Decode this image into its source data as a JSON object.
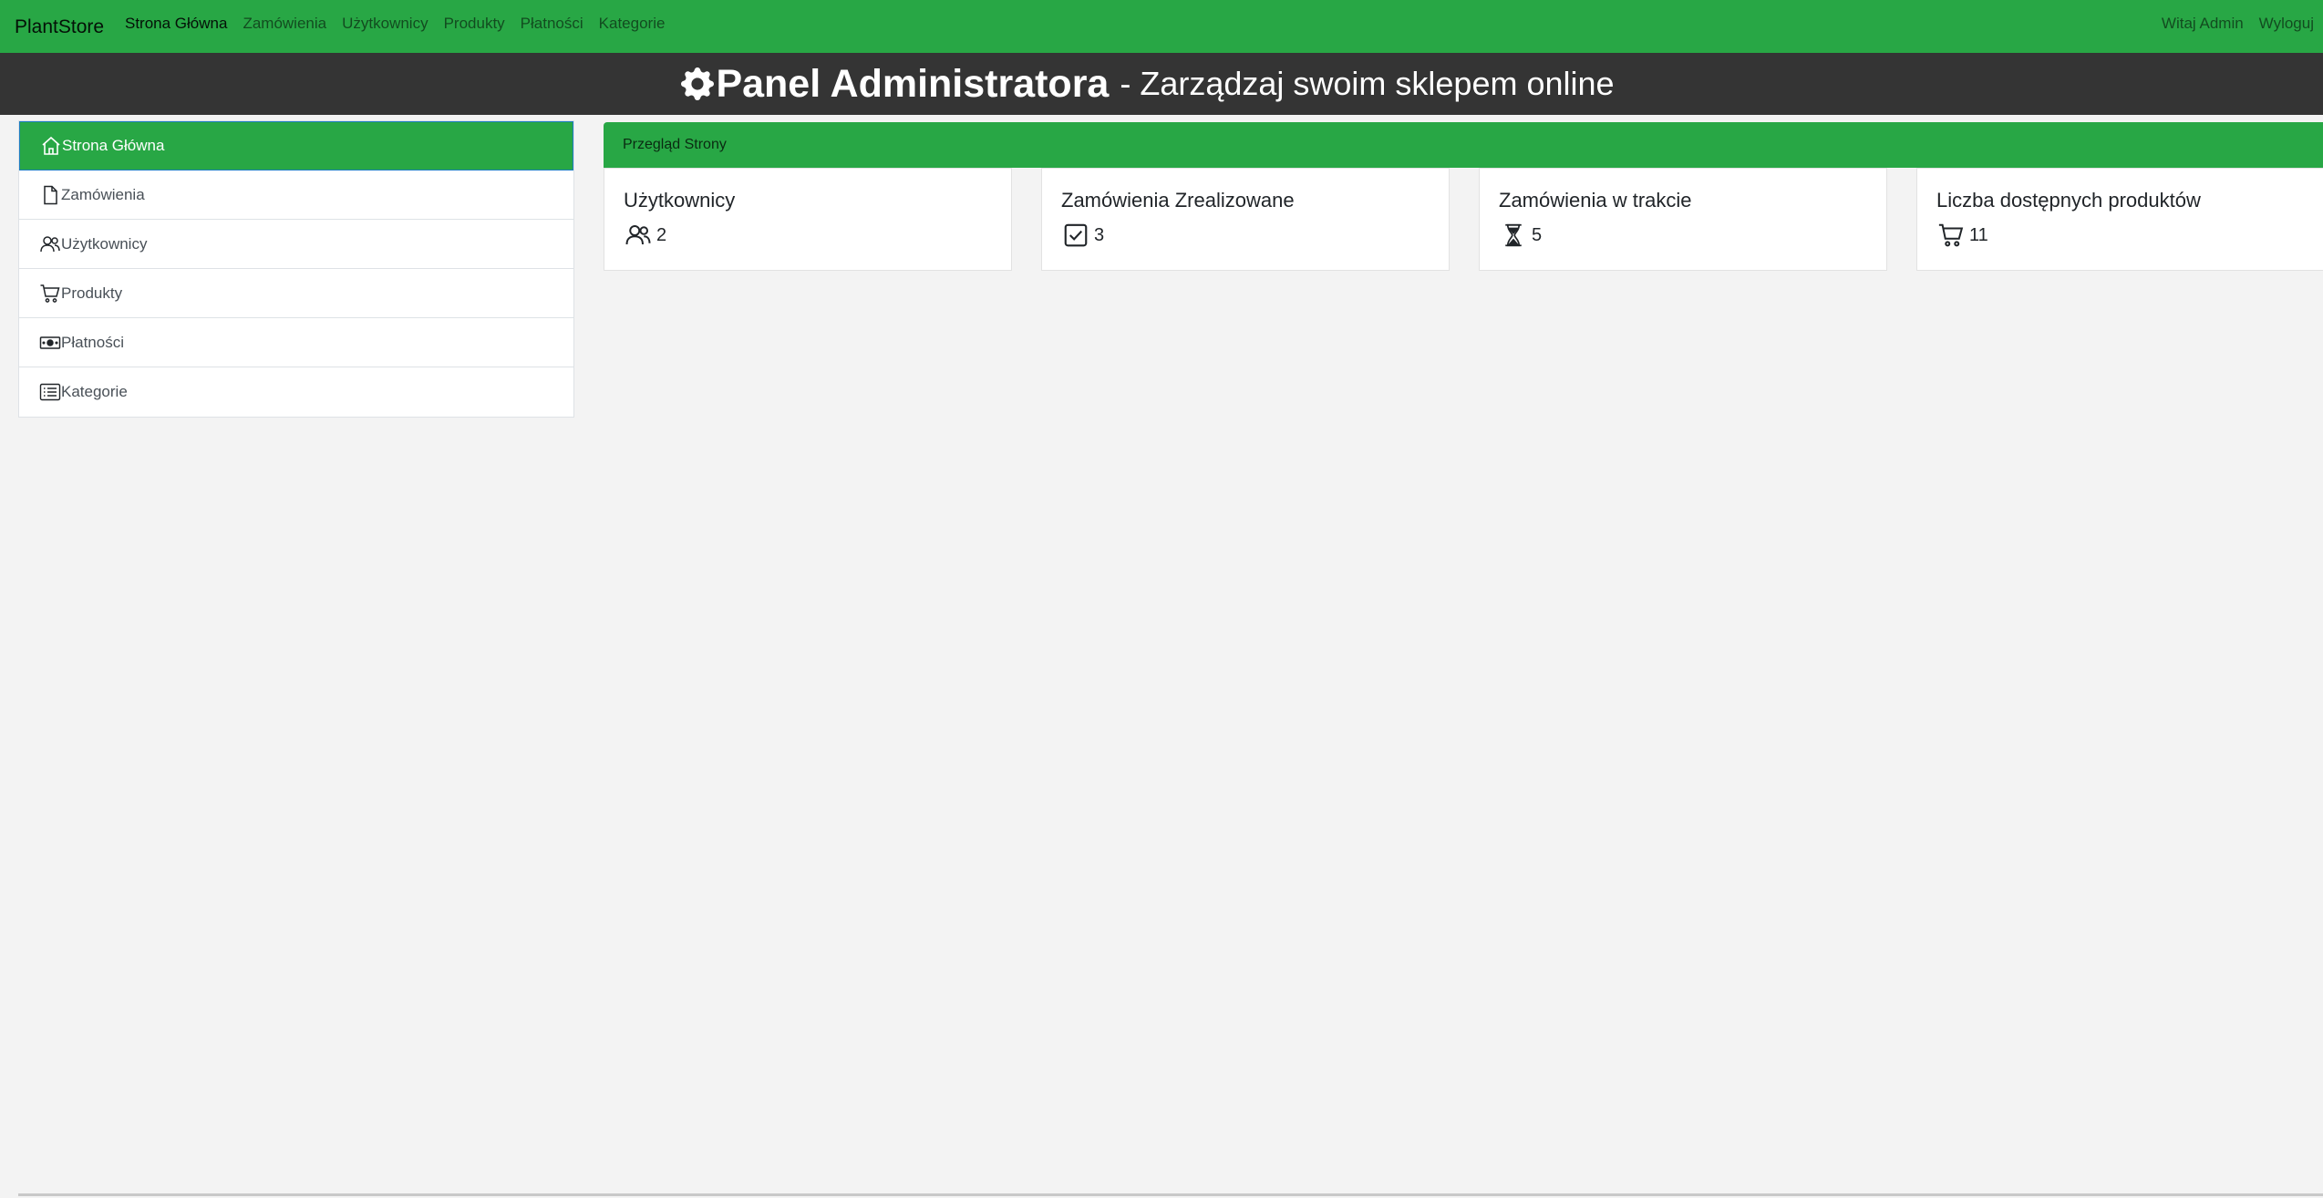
{
  "navbar": {
    "brand": "PlantStore",
    "links": [
      "Strona Główna",
      "Zamówienia",
      "Użytkownicy",
      "Produkty",
      "Płatności",
      "Kategorie"
    ],
    "greeting": "Witaj Admin",
    "logout": "Wyloguj",
    "bg_color": "#28a745"
  },
  "header": {
    "icon": "gear-icon",
    "title": "Panel Administratora",
    "subtitle": "- Zarządzaj swoim sklepem online"
  },
  "sidebar": {
    "items": [
      {
        "label": "Strona Główna",
        "icon": "house-icon",
        "active": true
      },
      {
        "label": "Zamówienia",
        "icon": "file-icon"
      },
      {
        "label": "Użytkownicy",
        "icon": "users-icon"
      },
      {
        "label": "Produkty",
        "icon": "cart-icon"
      },
      {
        "label": "Płatności",
        "icon": "cash-icon"
      },
      {
        "label": "Kategorie",
        "icon": "list-icon"
      }
    ]
  },
  "overview": {
    "title": "Przegląd Strony",
    "cards": [
      {
        "title": "Użytkownicy",
        "value": "2",
        "icon": "users-icon"
      },
      {
        "title": "Zamówienia Zrealizowane",
        "value": "3",
        "icon": "check-square-icon"
      },
      {
        "title": "Zamówienia w trakcie",
        "value": "5",
        "icon": "hourglass-icon"
      },
      {
        "title": "Liczba dostępnych produktów",
        "value": "11",
        "icon": "cart-icon"
      }
    ]
  }
}
